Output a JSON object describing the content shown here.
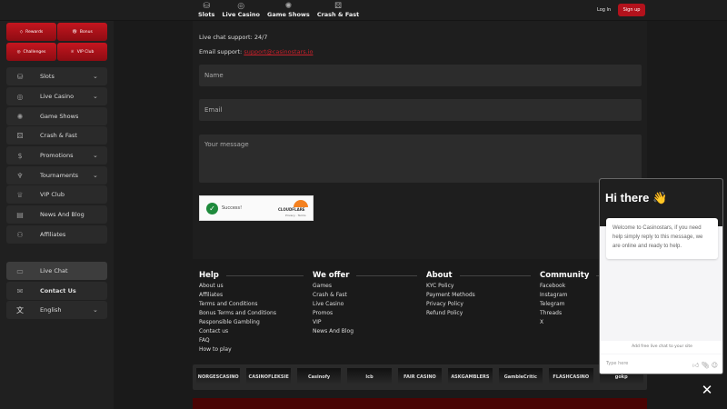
{
  "topnav": [
    {
      "label": "Slots",
      "icon": "slots-icon"
    },
    {
      "label": "Live Casino",
      "icon": "roulette-icon"
    },
    {
      "label": "Game Shows",
      "icon": "game-shows-icon"
    },
    {
      "label": "Crash & Fast",
      "icon": "dice-icon"
    }
  ],
  "auth": {
    "login": "Log In",
    "signup": "Sign up"
  },
  "colors": {
    "accent": "#b3121c",
    "link": "#c8202a"
  },
  "promos": [
    "Rewards",
    "Bonus",
    "Challenges",
    "VIP Club"
  ],
  "sidebar": [
    {
      "label": "Slots",
      "chevron": true
    },
    {
      "label": "Live Casino",
      "chevron": true
    },
    {
      "label": "Game Shows"
    },
    {
      "label": "Crash & Fast"
    },
    {
      "label": "Promotions",
      "chevron": true
    },
    {
      "label": "Tournaments",
      "chevron": true
    },
    {
      "label": "VIP Club"
    },
    {
      "label": "News And Blog"
    },
    {
      "label": "Affiliates"
    }
  ],
  "sidebar_bottom": [
    {
      "label": "Live Chat",
      "active": true
    },
    {
      "label": "Contact Us"
    },
    {
      "label": "English",
      "chevron": true
    }
  ],
  "contact": {
    "live_chat": "Live chat support: 24/7",
    "email_label": "Email support:",
    "email": "support@casinostars.io",
    "name_placeholder": "Name",
    "email_placeholder": "Email",
    "message_placeholder": "Your message",
    "captcha_status": "Success!",
    "captcha_brand": "CLOUDFLARE",
    "captcha_links": "Privacy · Terms"
  },
  "footer": [
    {
      "title": "Help",
      "links": [
        "About us",
        "Affiliates",
        "Terms and Conditions",
        "Bonus Terms and Conditions",
        "Responsible Gambling",
        "Contact us",
        "FAQ",
        "How to play"
      ]
    },
    {
      "title": "We offer",
      "links": [
        "Games",
        "Crash & Fast",
        "Live Casino",
        "Promos",
        "VIP",
        "News And Blog"
      ]
    },
    {
      "title": "About",
      "links": [
        "KYC Policy",
        "Payment Methods",
        "Privacy Policy",
        "Refund Policy"
      ]
    },
    {
      "title": "Community",
      "links": [
        "Facebook",
        "Instagram",
        "Telegram",
        "Threads",
        "X"
      ]
    }
  ],
  "logos": [
    "NORGESCASINO",
    "CASINOFLEKSIE",
    "Casinofy",
    "lcb",
    "FAIR CASINO",
    "ASKGAMBLERS",
    "GambleCritic",
    "FLASHCASINO",
    "gokp"
  ],
  "chat": {
    "title": "Hi there 👋",
    "message": "Welcome to Casinostars, if you need help simply reply to this message, we are online and ready to help.",
    "brand": "Add free live chat to your site",
    "placeholder": "Type here"
  }
}
